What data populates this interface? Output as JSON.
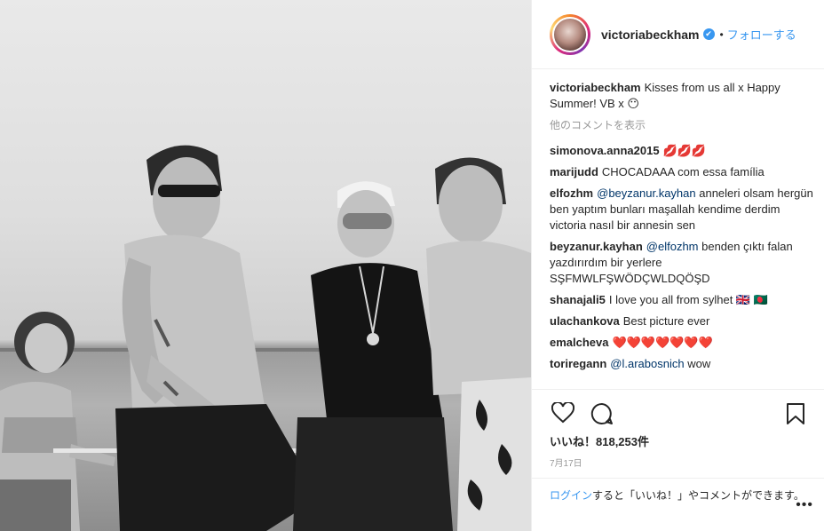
{
  "post": {
    "author": {
      "handle": "victoriabeckham",
      "verified_mark": "✔",
      "separator": "•",
      "follow_label": "フォローする"
    },
    "caption": {
      "user": "victoriabeckham",
      "text": "Kisses from us all x Happy Summer! VB x 😶"
    },
    "load_more_label": "他のコメントを表示",
    "comments": [
      {
        "user": "simonova.anna2015",
        "text": "💋💋💋"
      },
      {
        "user": "marijudd",
        "text": "CHOCADAAA com essa família"
      },
      {
        "user": "elfozhm",
        "mention": "@beyzanur.kayhan",
        "text": " anneleri olsam hergün ben yaptım bunları maşallah kendime derdim victoria nasıl bir annesin sen"
      },
      {
        "user": "beyzanur.kayhan",
        "mention": "@elfozhm",
        "text": " benden çıktı falan yazdırırdım bir yerlere SŞFMWLFŞWÖDÇWLDQÖŞD"
      },
      {
        "user": "shanajali5",
        "text": "I love you all from sylhet 🇬🇧 🇧🇩"
      },
      {
        "user": "ulachankova",
        "text": "Best picture ever"
      },
      {
        "user": "emalcheva",
        "text": "❤️❤️❤️❤️❤️❤️❤️"
      },
      {
        "user": "toriregann",
        "mention": "@l.arabosnich",
        "text": " wow"
      }
    ],
    "likes_label": "いいね！818,253件",
    "date": "7月17日",
    "footer": {
      "login_label": "ログイン",
      "rest": "すると「いいね！」やコメントができます。",
      "more_label": "•••"
    },
    "icons": {
      "like": "heart-icon",
      "comment": "comment-bubble-icon",
      "save": "bookmark-icon",
      "more": "more-options-icon"
    }
  }
}
